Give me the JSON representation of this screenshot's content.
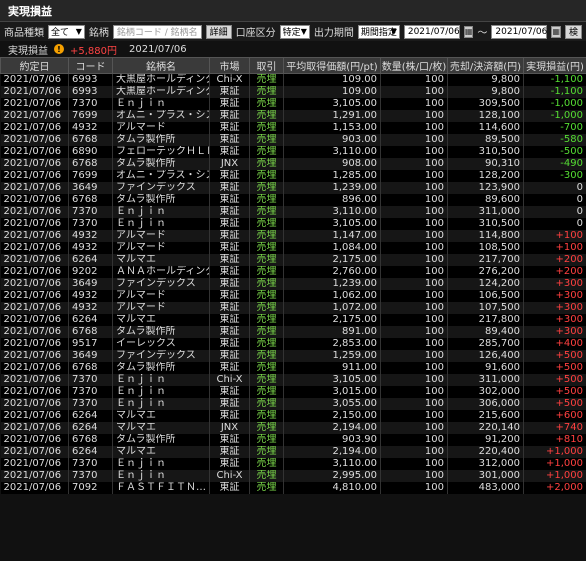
{
  "title": "実現損益",
  "filters": {
    "product_type_label": "商品種類",
    "product_type_value": "全て",
    "issue_label": "銘柄",
    "issue_placeholder": "銘柄コード / 銘柄名",
    "detail_button": "詳細",
    "account_label": "口座区分",
    "account_value": "特定",
    "period_label": "出力期間",
    "period_value": "期間指定",
    "date_from": "2021/07/06",
    "tilde": "～",
    "date_to": "2021/07/06",
    "search_button": "検"
  },
  "summary": {
    "label": "実現損益",
    "value": "+5,880円",
    "date": "2021/07/06"
  },
  "table": {
    "headers": [
      "約定日",
      "コード",
      "銘柄名",
      "市場",
      "取引",
      "平均取得価額(円/pt)",
      "数量(株/口/枚)",
      "売却/決済額(円)",
      "実現損益(円)"
    ],
    "rows": [
      [
        "2021/07/06",
        "6993",
        "大黒屋ホールディングス",
        "Chi-X",
        "売埋",
        "109.00",
        "100",
        "9,800",
        "-1,100"
      ],
      [
        "2021/07/06",
        "6993",
        "大黒屋ホールディングス",
        "東証",
        "売埋",
        "109.00",
        "100",
        "9,800",
        "-1,100"
      ],
      [
        "2021/07/06",
        "7370",
        "Ｅｎｊｉｎ",
        "東証",
        "売埋",
        "3,105.00",
        "100",
        "309,500",
        "-1,000"
      ],
      [
        "2021/07/06",
        "7699",
        "オムニ・プラス・システ…",
        "東証",
        "売埋",
        "1,291.00",
        "100",
        "128,100",
        "-1,000"
      ],
      [
        "2021/07/06",
        "4932",
        "アルマード",
        "東証",
        "売埋",
        "1,153.00",
        "100",
        "114,600",
        "-700"
      ],
      [
        "2021/07/06",
        "6768",
        "タムラ製作所",
        "東証",
        "売埋",
        "903.00",
        "100",
        "89,500",
        "-580"
      ],
      [
        "2021/07/06",
        "6890",
        "フェローテックＨＬＤ…",
        "東証",
        "売埋",
        "3,110.00",
        "100",
        "310,500",
        "-500"
      ],
      [
        "2021/07/06",
        "6768",
        "タムラ製作所",
        "JNX",
        "売埋",
        "908.00",
        "100",
        "90,310",
        "-490"
      ],
      [
        "2021/07/06",
        "7699",
        "オムニ・プラス・システ…",
        "東証",
        "売埋",
        "1,285.00",
        "100",
        "128,200",
        "-300"
      ],
      [
        "2021/07/06",
        "3649",
        "ファインデックス",
        "東証",
        "売埋",
        "1,239.00",
        "100",
        "123,900",
        "0"
      ],
      [
        "2021/07/06",
        "6768",
        "タムラ製作所",
        "東証",
        "売埋",
        "896.00",
        "100",
        "89,600",
        "0"
      ],
      [
        "2021/07/06",
        "7370",
        "Ｅｎｊｉｎ",
        "東証",
        "売埋",
        "3,110.00",
        "100",
        "311,000",
        "0"
      ],
      [
        "2021/07/06",
        "7370",
        "Ｅｎｊｉｎ",
        "東証",
        "売埋",
        "3,105.00",
        "100",
        "310,500",
        "0"
      ],
      [
        "2021/07/06",
        "4932",
        "アルマード",
        "東証",
        "売埋",
        "1,147.00",
        "100",
        "114,800",
        "+100"
      ],
      [
        "2021/07/06",
        "4932",
        "アルマード",
        "東証",
        "売埋",
        "1,084.00",
        "100",
        "108,500",
        "+100"
      ],
      [
        "2021/07/06",
        "6264",
        "マルマエ",
        "東証",
        "売埋",
        "2,175.00",
        "100",
        "217,700",
        "+200"
      ],
      [
        "2021/07/06",
        "9202",
        "ＡＮＡホールディングス",
        "東証",
        "売埋",
        "2,760.00",
        "100",
        "276,200",
        "+200"
      ],
      [
        "2021/07/06",
        "3649",
        "ファインデックス",
        "東証",
        "売埋",
        "1,239.00",
        "100",
        "124,200",
        "+300"
      ],
      [
        "2021/07/06",
        "4932",
        "アルマード",
        "東証",
        "売埋",
        "1,062.00",
        "100",
        "106,500",
        "+300"
      ],
      [
        "2021/07/06",
        "4932",
        "アルマード",
        "東証",
        "売埋",
        "1,072.00",
        "100",
        "107,500",
        "+300"
      ],
      [
        "2021/07/06",
        "6264",
        "マルマエ",
        "東証",
        "売埋",
        "2,175.00",
        "100",
        "217,800",
        "+300"
      ],
      [
        "2021/07/06",
        "6768",
        "タムラ製作所",
        "東証",
        "売埋",
        "891.00",
        "100",
        "89,400",
        "+300"
      ],
      [
        "2021/07/06",
        "9517",
        "イーレックス",
        "東証",
        "売埋",
        "2,853.00",
        "100",
        "285,700",
        "+400"
      ],
      [
        "2021/07/06",
        "3649",
        "ファインデックス",
        "東証",
        "売埋",
        "1,259.00",
        "100",
        "126,400",
        "+500"
      ],
      [
        "2021/07/06",
        "6768",
        "タムラ製作所",
        "東証",
        "売埋",
        "911.00",
        "100",
        "91,600",
        "+500"
      ],
      [
        "2021/07/06",
        "7370",
        "Ｅｎｊｉｎ",
        "Chi-X",
        "売埋",
        "3,105.00",
        "100",
        "311,000",
        "+500"
      ],
      [
        "2021/07/06",
        "7370",
        "Ｅｎｊｉｎ",
        "東証",
        "売埋",
        "3,015.00",
        "100",
        "302,000",
        "+500"
      ],
      [
        "2021/07/06",
        "7370",
        "Ｅｎｊｉｎ",
        "東証",
        "売埋",
        "3,055.00",
        "100",
        "306,000",
        "+500"
      ],
      [
        "2021/07/06",
        "6264",
        "マルマエ",
        "東証",
        "売埋",
        "2,150.00",
        "100",
        "215,600",
        "+600"
      ],
      [
        "2021/07/06",
        "6264",
        "マルマエ",
        "JNX",
        "売埋",
        "2,194.00",
        "100",
        "220,140",
        "+740"
      ],
      [
        "2021/07/06",
        "6768",
        "タムラ製作所",
        "東証",
        "売埋",
        "903.90",
        "100",
        "91,200",
        "+810"
      ],
      [
        "2021/07/06",
        "6264",
        "マルマエ",
        "東証",
        "売埋",
        "2,194.00",
        "100",
        "220,400",
        "+1,000"
      ],
      [
        "2021/07/06",
        "7370",
        "Ｅｎｊｉｎ",
        "東証",
        "売埋",
        "3,110.00",
        "100",
        "312,000",
        "+1,000"
      ],
      [
        "2021/07/06",
        "7370",
        "Ｅｎｊｉｎ",
        "Chi-X",
        "売埋",
        "2,995.00",
        "100",
        "301,000",
        "+1,000"
      ],
      [
        "2021/07/06",
        "7092",
        "ＦＡＳＴＦＩＴＮ…",
        "東証",
        "売埋",
        "4,810.00",
        "100",
        "483,000",
        "+2,000"
      ]
    ]
  },
  "colors": {
    "profit": "#ff4040",
    "loss": "#55dd33",
    "trade": "#7bd84a"
  },
  "icons": {
    "date_picker": "calendar-icon",
    "warning": "warning-icon",
    "dropdown": "chevron-down-icon"
  }
}
